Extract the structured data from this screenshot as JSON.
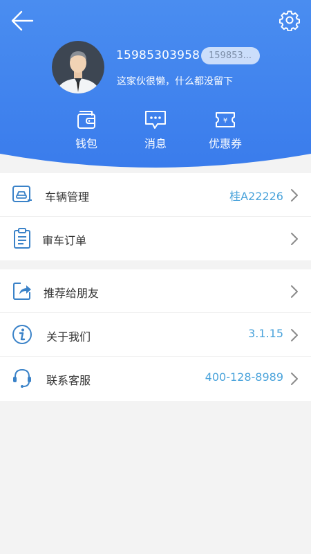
{
  "theme": {
    "header_top": "#4a8df0",
    "header_bottom": "#3b7eee",
    "accent_value": "#4aa3db",
    "icon_color": "#3a82c8"
  },
  "profile": {
    "phone": "15985303958",
    "phone_tag": "159853...",
    "bio": "这家伙很懒，什么都没留下"
  },
  "quick_actions": [
    {
      "label": "钱包",
      "icon": "wallet-icon"
    },
    {
      "label": "消息",
      "icon": "message-icon"
    },
    {
      "label": "优惠券",
      "icon": "coupon-icon"
    }
  ],
  "menu_group_1": [
    {
      "label": "车辆管理",
      "value": "桂A22226",
      "icon": "car-icon"
    },
    {
      "label": "审车订单",
      "value": "",
      "icon": "clipboard-icon"
    }
  ],
  "menu_group_2": [
    {
      "label": "推荐给朋友",
      "value": "",
      "icon": "share-icon"
    },
    {
      "label": "关于我们",
      "value": "3.1.15",
      "icon": "info-icon"
    },
    {
      "label": "联系客服",
      "value": "400-128-8989",
      "icon": "headset-icon"
    }
  ]
}
